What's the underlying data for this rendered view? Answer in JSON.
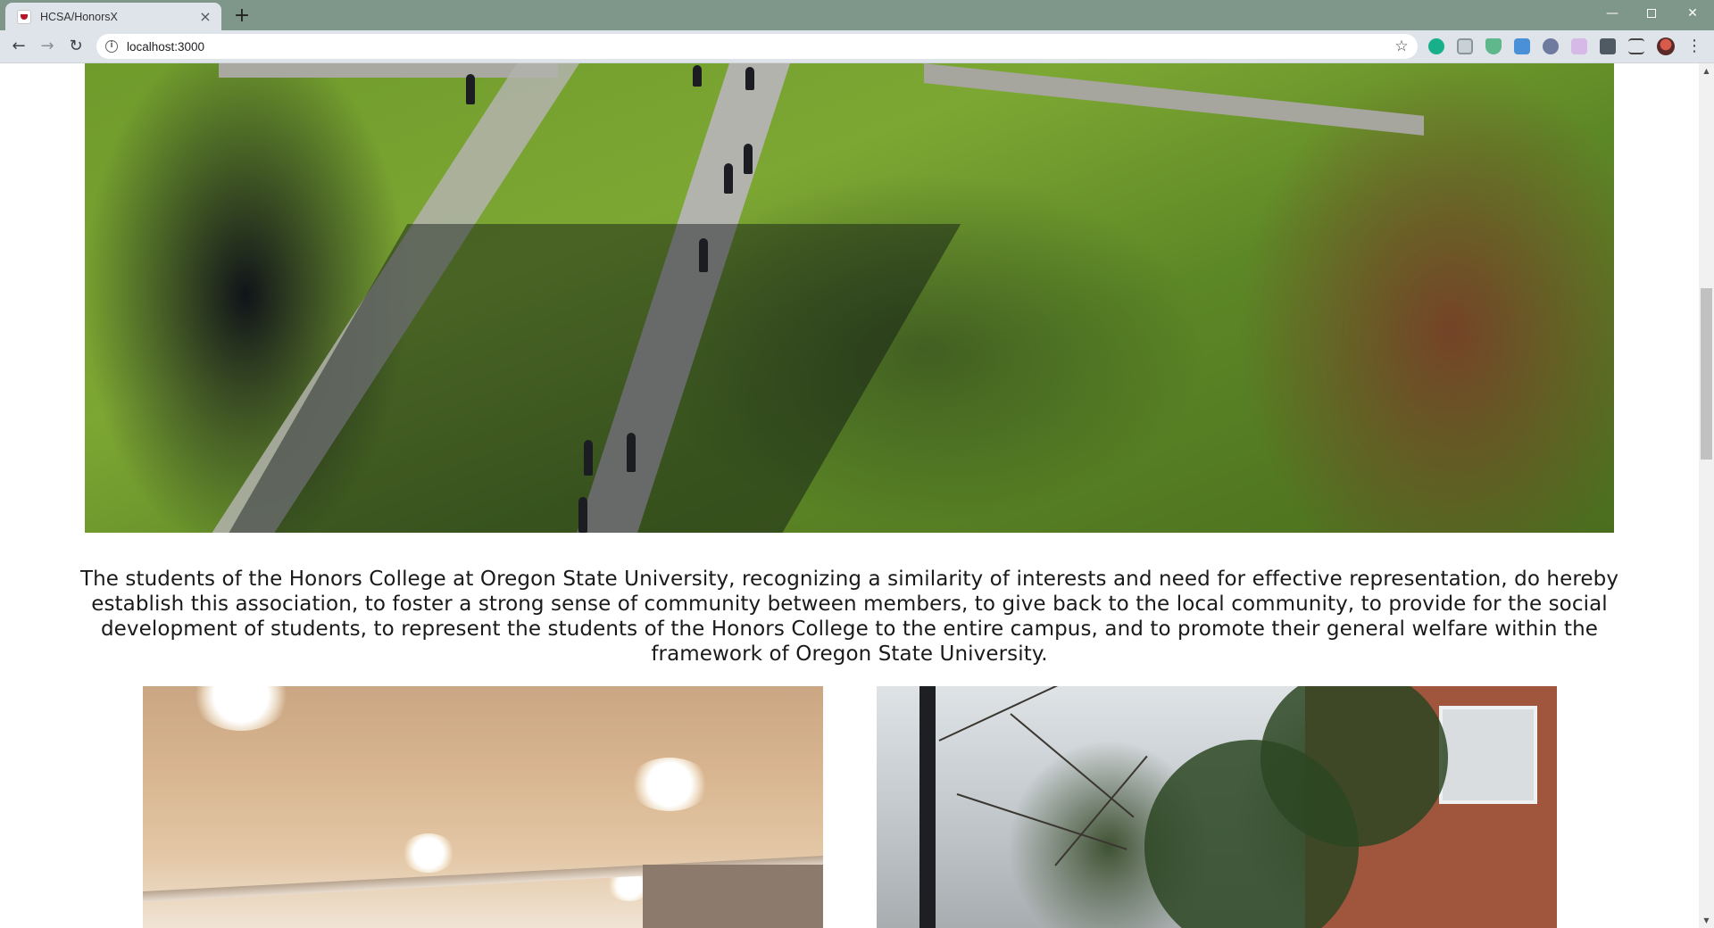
{
  "browser": {
    "tab_title": "HCSA/HonorsX",
    "tab_close_icon": "×",
    "new_tab_icon": "+",
    "url": "localhost:3000",
    "window_controls": {
      "minimize": "—",
      "restore": "❐",
      "close": "✕"
    },
    "nav": {
      "back": "←",
      "forward": "→",
      "reload": "↻"
    },
    "star_icon": "☆",
    "menu_icon": "⋮"
  },
  "page": {
    "mission_text": "The students of the Honors College at Oregon State University, recognizing a similarity of interests and need for effective representation, do hereby establish this association, to foster a strong sense of community between members, to give back to the local community, to provide for the social development of students, to represent the students of the Honors College to the entire campus, and to promote their general welfare within the framework of Oregon State University."
  },
  "colors": {
    "tabbar": "#7f978a",
    "toolbar": "#dfe4ea",
    "text": "#1a1a1a"
  }
}
